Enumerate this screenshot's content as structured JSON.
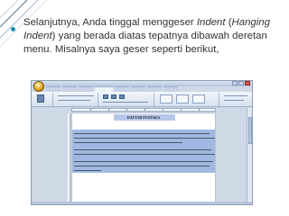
{
  "slide": {
    "bullet_part1": "Selanjutnya, Anda tinggal menggeser ",
    "indent_word": "Indent",
    "bullet_part2": " (",
    "hanging_word": "Hanging Indent",
    "bullet_part3": ")  yang  berada diatas tepatnya dibawah deretan menu. Misalnya saya geser seperti berikut,"
  },
  "colors": {
    "bullet": "#1f8fa6",
    "text": "#333333",
    "corner_accent": "#6f8aa1",
    "selection": "#9fb9e2"
  },
  "screenshot": {
    "document_heading": "DAFTAR PUSTAKA"
  }
}
